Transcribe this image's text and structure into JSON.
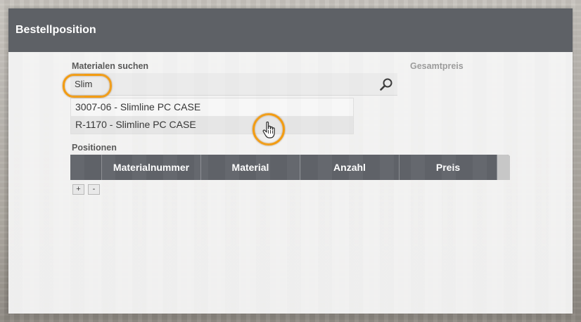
{
  "window": {
    "title": "Bestellposition"
  },
  "search": {
    "label": "Materialen suchen",
    "value": "Slim",
    "placeholder": "",
    "results": [
      "3007-06 - Slimline PC CASE",
      "R-1170 - Slimline PC CASE"
    ],
    "hovered_index": 1
  },
  "total": {
    "label": "Gesamtpreis"
  },
  "positions": {
    "label": "Positionen",
    "columns": [
      "",
      "Materialnummer",
      "Material",
      "Anzahl",
      "Preis"
    ],
    "add_label": "+",
    "remove_label": "-"
  },
  "colors": {
    "accent": "#f39c12",
    "titlebar": "#5e6166",
    "table_header": "#5f6268"
  },
  "icons": [
    "search-icon",
    "hand-pointer-icon"
  ]
}
